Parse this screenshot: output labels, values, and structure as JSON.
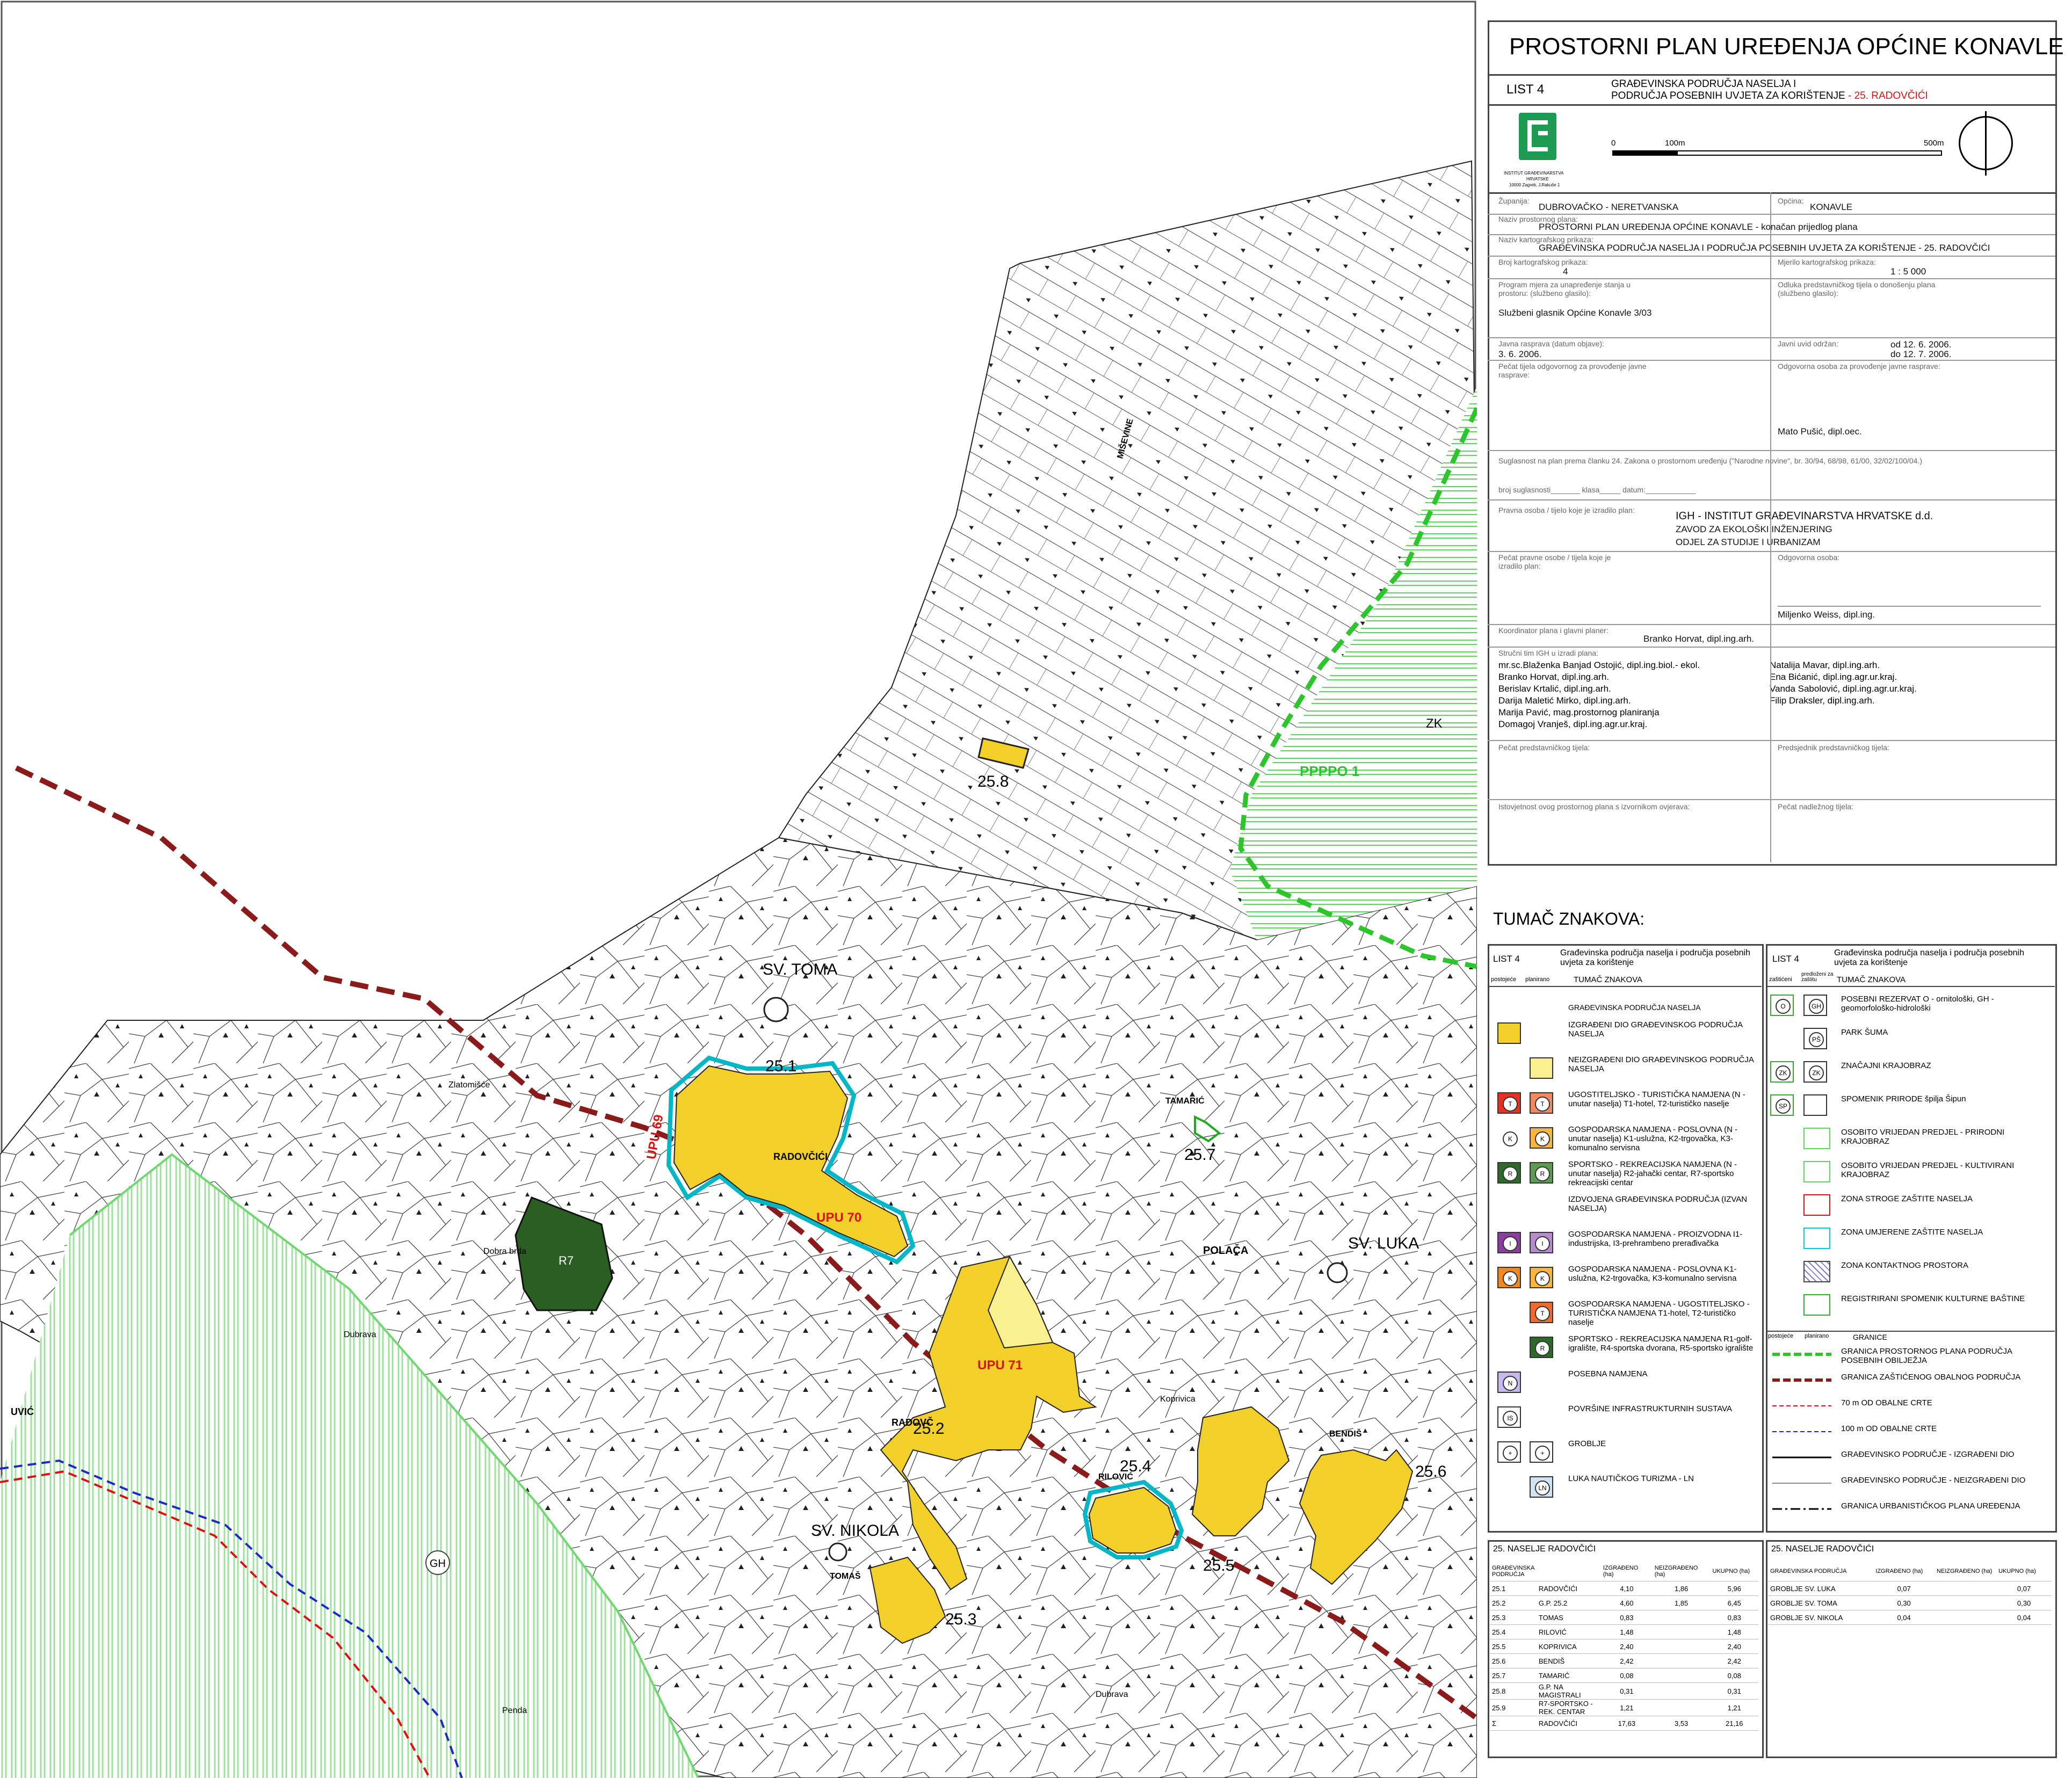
{
  "title": "PROSTORNI PLAN UREĐENJA OPĆINE KONAVLE",
  "sheet": {
    "list": "LIST 4",
    "subtitle_line1": "GRAĐEVINSKA PODRUČJA NASELJA I",
    "subtitle_line2": "PODRUČJA POSEBNIH UVJETA ZA KORIŠTENJE",
    "subtitle_red": "- 25. RADOVČIĆI"
  },
  "scale_bar": {
    "t0": "0",
    "t1": "100m",
    "t2": "500m"
  },
  "institute_lines": [
    "INSTITUT GRAĐEVINARSTVA",
    "HRVATSKE",
    "10000 Zagreb, J.Rakuše 1"
  ],
  "info": {
    "zupanija_label": "Županija:",
    "zupanija": "DUBROVAČKO - NERETVANSKA",
    "opcina_label": "Općina:",
    "opcina": "KONAVLE",
    "naziv_plana_label": "Naziv prostornog plana:",
    "naziv_plana": "PROSTORNI PLAN UREĐENJA OPĆINE KONAVLE - konačan prijedlog plana",
    "naziv_prikaza_label": "Naziv kartografskog prikaza:",
    "naziv_prikaza": "GRAĐEVINSKA PODRUČJA NASELJA I PODRUČJA POSEBNIH UVJETA ZA KORIŠTENJE - 25. RADOVČIĆI",
    "broj_label": "Broj kartografskog prikaza:",
    "broj": "4",
    "mjerilo_label": "Mjerilo kartografskog prikaza:",
    "mjerilo": "1 : 5 000",
    "program_label": "Program mjera za unapređenje stanja u prostoru: (službeno glasilo):",
    "program": "Službeni glasnik Općine Konavle 3/03",
    "odluka_label": "Odluka predstavničkog tijela o donošenju plana (službeno glasilo):",
    "rasprava_label": "Javna rasprava (datum objave):",
    "rasprava": "3. 6. 2006.",
    "uvid_label": "Javni uvid održan:",
    "uvid1": "od 12. 6. 2006.",
    "uvid2": "do 12. 7. 2006.",
    "pecat_label": "Pečat tijela odgovornog za provođenje javne rasprave:",
    "odgovorna_label": "Odgovorna osoba za provođenje javne rasprave:",
    "odgovorna": "Mato Pušić, dipl.oec.",
    "suglasnost": "Suglasnost na plan prema članku   24.  Zakona o prostornom uređenju   (\"Narodne novine\", br. 30/94, 68/98, 61/00, 32/02/100/04.)",
    "broj_suglasnosti": "broj suglasnosti_______  klasa_____                datum:____________",
    "pravna_label": "Pravna osoba / tijelo koje je izradilo plan:",
    "pravna1": "IGH - INSTITUT GRAĐEVINARSTVA HRVATSKE d.d.",
    "pravna2": "ZAVOD ZA EKOLOŠKI INŽENJERING",
    "pravna3": "ODJEL ZA STUDIJE I URBANIZAM",
    "pecat_pravne_label": "Pečat pravne osobe / tijela koje je izradilo plan:",
    "odgovorna2_label": "Odgovorna osoba:",
    "odgovorna2": "Miljenko Weiss, dipl.ing.",
    "koordinator_label": "Koordinator plana i glavni planer:",
    "koordinator": "Branko Horvat, dipl.ing.arh.",
    "strucni_label": "Stručni tim IGH u izradi plana:",
    "strucni_left": [
      "mr.sc.Blaženka Banjad Ostojić, dipl.ing.biol.- ekol.",
      "Branko Horvat, dipl.ing.arh.",
      "Berislav Krtalić, dipl.ing.arh.",
      "Darija Maletić Mirko, dipl.ing.arh.",
      "Marija Pavić, mag.prostornog planiranja",
      "Domagoj Vranješ, dipl.ing.agr.ur.kraj."
    ],
    "strucni_right": [
      "Natalija Mavar, dipl.ing.arh.",
      "Ena Bićanić, dipl.ing.agr.ur.kraj.",
      "Vanda Sabolović, dipl.ing.agr.ur.kraj.",
      "Filip Draksler, dipl.ing.arh."
    ],
    "pecat_pred_label": "Pečat predstavničkog tijela:",
    "predsjednik_label": "Predsjednik predstavničkog tijela:",
    "istovjetnost_label": "Istovjetnost ovog prostornog plana s izvornikom ovjerava:",
    "nadlezni_label": "Pečat nadležnog tijela:"
  },
  "legend": {
    "title": "TUMAČ ZNAKOVA:",
    "left_header": {
      "list": "LIST 4",
      "text": "Građevinska područja naselja i područja posebnih uvjeta za korištenje",
      "col1": "postojeće",
      "col2": "planirano",
      "col3": "TUMAČ ZNAKOVA"
    },
    "right_header": {
      "list": "LIST 4",
      "text": "Građevinska područja naselja i područja posebnih uvjeta za korištenje",
      "col1": "zaštićeni",
      "col2": "predloženi za zaštitu",
      "col3": "TUMAČ ZNAKOVA"
    },
    "left_section": "GRAĐEVINSKA PODRUČJA NASELJA",
    "left_items": [
      {
        "a": "",
        "b": "",
        "text": "IZGRAĐENI DIO GRAĐEVINSKOG PODRUČJA NASELJA",
        "fill": "#f2cf29",
        "fill2": ""
      },
      {
        "a": "",
        "b": "",
        "text": "NEIZGRAĐENI DIO GRAĐEVINSKOG PODRUČJA NASELJA",
        "fill": "",
        "fill2": "#fbf08f"
      },
      {
        "a": "T",
        "b": "T",
        "text": "UGOSTITELJSKO - TURISTIČKA NAMJENA (N - unutar naselja) T1-hotel, T2-turističko naselje",
        "fill": "#e53224",
        "fill2": "#f08a60"
      },
      {
        "a": "K",
        "b": "K",
        "text": "GOSPODARSKA NAMJENA - POSLOVNA (N - unutar naselja) K1-uslužna, K2-trgovačka, K3-komunalno servisna",
        "fill": "",
        "fill2": "#f6b640"
      },
      {
        "a": "R",
        "b": "R",
        "text": "SPORTSKO - REKREACIJSKA NAMJENA (N - unutar naselja) R2-jahački centar, R7-sportsko rekreacijski centar",
        "fill": "#2e6b2a",
        "fill2": "#5d9b50"
      },
      {
        "a": "",
        "b": "",
        "text": "IZDVOJENA GRAĐEVINSKA PODRUČJA (IZVAN NASELJA)",
        "fill": "",
        "fill2": ""
      },
      {
        "a": "I",
        "b": "I",
        "text": "GOSPODARSKA NAMJENA - PROIZVODNA I1-industrijska, I3-prehrambeno prerađivačka",
        "fill": "#8a3fa0",
        "fill2": "#b58ccc"
      },
      {
        "a": "K",
        "b": "K",
        "text": "GOSPODARSKA NAMJENA - POSLOVNA K1-uslužna, K2-trgovačka, K3-komunalno servisna",
        "fill": "#f08a20",
        "fill2": "#f6b640"
      },
      {
        "a": "",
        "b": "T",
        "text": "GOSPODARSKA NAMJENA - UGOSTITELJSKO - TURISTIČKA NAMJENA T1-hotel, T2-turističko naselje",
        "fill": "",
        "fill2": "#f06a30"
      },
      {
        "a": "",
        "b": "R",
        "text": "SPORTSKO - REKREACIJSKA NAMJENA R1-golf-igralište, R4-sportska dvorana, R5-sportsko igralište",
        "fill": "",
        "fill2": "#2e6b2a"
      },
      {
        "a": "N",
        "b": "",
        "text": "POSEBNA NAMJENA",
        "fill": "#c7b8f0",
        "fill2": ""
      },
      {
        "a": "IS",
        "b": "",
        "text": "POVRŠINE INFRASTRUKTURNIH SUSTAVA",
        "fill": "#ffffff",
        "fill2": ""
      },
      {
        "a": "+",
        "b": "+",
        "text": "GROBLJE",
        "fill": "#ffffff",
        "fill2": "#ffffff"
      },
      {
        "a": "",
        "b": "LN",
        "text": "LUKA NAUTIČKOG TURIZMA - LN",
        "fill": "",
        "fill2": "#cfe3f3"
      }
    ],
    "right_items": [
      {
        "a": "O",
        "b": "GH",
        "text": "POSEBNI REZERVAT O - ornitološki, GH - geomorfološko-hidrološki"
      },
      {
        "a": "",
        "b": "PŠ",
        "text": "PARK ŠUMA"
      },
      {
        "a": "ZK",
        "b": "ZK",
        "text": "ZNAČAJNI KRAJOBRAZ"
      },
      {
        "a": "SP",
        "b": "",
        "text": "SPOMENIK PRIRODE špilja Šipun"
      },
      {
        "a": "",
        "b": "",
        "text": "OSOBITO VRIJEDAN PREDJEL - PRIRODNI KRAJOBRAZ"
      },
      {
        "a": "",
        "b": "",
        "text": "OSOBITO VRIJEDAN PREDJEL - KULTIVIRANI KRAJOBRAZ"
      },
      {
        "a": "",
        "b": "",
        "text": "ZONA STROGE ZAŠTITE NASELJA"
      },
      {
        "a": "",
        "b": "",
        "text": "ZONA UMJERENE ZAŠTITE NASELJA"
      },
      {
        "a": "",
        "b": "",
        "text": "ZONA KONTAKTNOG PROSTORA"
      },
      {
        "a": "",
        "b": "",
        "text": "REGISTRIRANI SPOMENIK KULTURNE BAŠTINE"
      }
    ],
    "line_header": {
      "col1": "postojeće",
      "col2": "planirano",
      "section": "GRANICE"
    },
    "line_items": [
      {
        "text": "GRANICA PROSTORNOG PLANA PODRUČJA POSEBNIH OBILJEŽJA"
      },
      {
        "text": "GRANICA ZAŠTIĆENOG OBALNOG PODRUČJA"
      },
      {
        "text": "70 m OD OBALNE CRTE"
      },
      {
        "text": "100 m OD OBALNE CRTE"
      },
      {
        "text": "GRAĐEVINSKO PODRUČJE - IZGRAĐENI DIO"
      },
      {
        "text": "GRAĐEVINSKO PODRUČJE - NEIZGRAĐENI DIO"
      },
      {
        "text": "GRANICA URBANISTIČKOG PLANA UREĐENJA"
      }
    ]
  },
  "table1": {
    "title": "25. NASELJE RADOVČIĆI",
    "headers": [
      "GRAĐEVINSKA PODRUČJA",
      "IZGRAĐENO (ha)",
      "NEIZGRAĐENO (ha)",
      "UKUPNO (ha)"
    ],
    "rows": [
      [
        "25.1",
        "RADOVČIĆI",
        "4,10",
        "1,86",
        "5,96"
      ],
      [
        "25.2",
        "G.P. 25.2",
        "4,60",
        "1,85",
        "6,45"
      ],
      [
        "25.3",
        "TOMAS",
        "0,83",
        "",
        "0,83"
      ],
      [
        "25.4",
        "RILOVIĆ",
        "1,48",
        "",
        "1,48"
      ],
      [
        "25.5",
        "KOPRIVICA",
        "2,40",
        "",
        "2,40"
      ],
      [
        "25.6",
        "BENDIŠ",
        "2,42",
        "",
        "2,42"
      ],
      [
        "25.7",
        "TAMARIĆ",
        "0,08",
        "",
        "0,08"
      ],
      [
        "25.8",
        "G.P. NA MAGISTRALI",
        "0,31",
        "",
        "0,31"
      ],
      [
        "25.9",
        "R7-SPORTSKO - REK. CENTAR",
        "1,21",
        "",
        "1,21"
      ],
      [
        "Σ",
        "RADOVČIĆI",
        "17,63",
        "3,53",
        "21,16"
      ]
    ]
  },
  "table2": {
    "title": "25. NASELJE RADOVČIĆI",
    "headers": [
      "GRAĐEVINSKA PODRUČJA",
      "IZGRAĐENO (ha)",
      "NEIZGRAĐENO (ha)",
      "UKUPNO (ha)"
    ],
    "rows": [
      [
        "GROBLJE SV. LUKA",
        "0,07",
        "",
        "0,07"
      ],
      [
        "GROBLJE SV. TOMA",
        "0,30",
        "",
        "0,30"
      ],
      [
        "GROBLJE SV. NIKOLA",
        "0,04",
        "",
        "0,04"
      ]
    ]
  },
  "map_labels": {
    "sv_toma": "SV. TOMA",
    "sv_luka": "SV. LUKA",
    "sv_nikola": "SV. NIKOLA",
    "upu69": "UPU 69",
    "upu70": "UPU 70",
    "upu71": "UPU 71",
    "ppppo": "PPPPO 1",
    "zk": "ZK",
    "gh": "GH",
    "r7": "R7",
    "z25_1": "25.1",
    "z25_2": "25.2",
    "z25_3": "25.3",
    "z25_4": "25.4",
    "z25_5": "25.5",
    "z25_6": "25.6",
    "z25_7": "25.7",
    "z25_8": "25.8",
    "radovcici": "RADOVČIĆI",
    "radovcic2": "RADOVČ",
    "tomas": "TOMAŠ",
    "rilovic": "RILOVIĆ",
    "tamaric": "TAMARIĆ",
    "polaca": "POLAČA",
    "koprivica": "Koprivica",
    "bendis": "BENDIŠ",
    "misevine": "MIŠEVINE",
    "dubrava1": "Dubrava",
    "dubrava2": "Dubrava",
    "dobra_brda": "Dobra brda",
    "zlatomirke": "Zlatomišće",
    "penda": "Penda",
    "uvic": "UVIĆ"
  },
  "colors": {
    "built": "#f2cf29",
    "unbuilt": "#fbf08f",
    "green_zone": "#2cc52c",
    "coast_line": "#8b1a1a",
    "upu_border": "#00b7c8",
    "forest": "#2a5e22"
  }
}
